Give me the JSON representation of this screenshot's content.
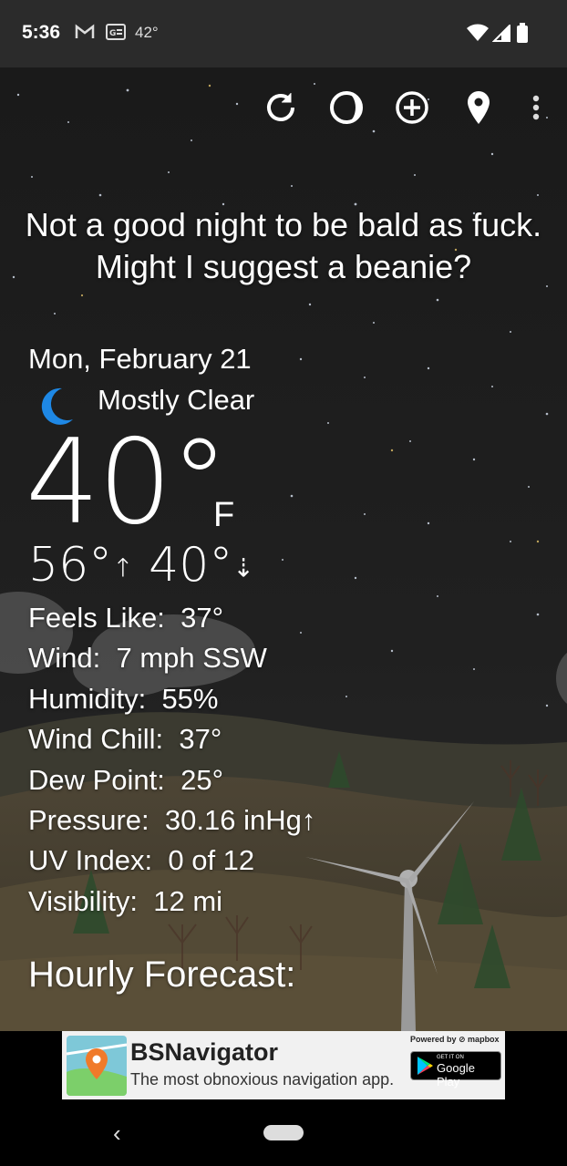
{
  "status_bar": {
    "time": "5:36",
    "temperature": "42°",
    "icons": [
      "gmail-icon",
      "news-icon",
      "wifi-icon",
      "signal-icon",
      "battery-icon"
    ]
  },
  "toolbar": {
    "icons": [
      "refresh-icon",
      "moon-phase-icon",
      "add-location-icon",
      "location-pin-icon",
      "more-vert-icon"
    ]
  },
  "weather": {
    "snark": "Not a good night to be bald as fuck. Might I suggest a beanie?",
    "date": "Mon, February 21",
    "condition": "Mostly Clear",
    "condition_icon": "moon-icon",
    "temperature": "40°",
    "unit": "F",
    "high": "56°",
    "low": "40°",
    "details": [
      {
        "label": "Feels Like:",
        "value": "37°"
      },
      {
        "label": "Wind:",
        "value": "7 mph SSW"
      },
      {
        "label": "Humidity:",
        "value": "55%"
      },
      {
        "label": "Wind Chill:",
        "value": "37°"
      },
      {
        "label": "Dew Point:",
        "value": "25°"
      },
      {
        "label": "Pressure:",
        "value": "30.16 inHg↑"
      },
      {
        "label": "UV Index:",
        "value": "0 of 12"
      },
      {
        "label": "Visibility:",
        "value": "12 mi"
      }
    ],
    "hourly_title": "Hourly Forecast:"
  },
  "ad": {
    "title": "BSNavigator",
    "subtitle": "The most obnoxious navigation app.",
    "powered_by": "Powered by ⊘ mapbox",
    "gplay_small": "GET IT ON",
    "gplay_text": "Google Play"
  },
  "navigation": {
    "back": "‹"
  },
  "colors": {
    "accent_blue": "#1e88e5",
    "night_sky": "#1b1b1b",
    "hill": "#4a4030"
  }
}
